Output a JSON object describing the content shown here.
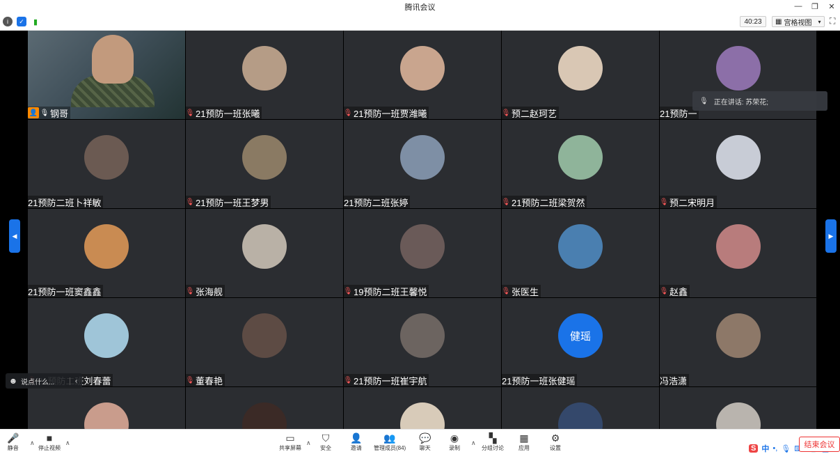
{
  "window": {
    "title": "腾讯会议"
  },
  "toolbar": {
    "timer": "40:23",
    "view_mode": "宫格视图"
  },
  "speaking": {
    "text": "正在讲话: 苏荣花;"
  },
  "chat": {
    "placeholder": "说点什么..."
  },
  "tiles": [
    {
      "name": "钢哥",
      "type": "video",
      "host": true,
      "muted": false
    },
    {
      "name": "21预防一班张曦",
      "muted": true,
      "color": "#b59c86"
    },
    {
      "name": "21预防一班贾潍曦",
      "muted": true,
      "color": "#c9a58e"
    },
    {
      "name": "预二赵珂艺",
      "muted": true,
      "color": "#d9c7b4"
    },
    {
      "name": "21预防一",
      "muted": false,
      "color": "#8c6fa8"
    },
    {
      "name": "21预防二班卜祥敏",
      "muted": false,
      "color": "#6b5a52"
    },
    {
      "name": "21预防一班王梦男",
      "muted": true,
      "color": "#8a7a63"
    },
    {
      "name": "21预防二班张婷",
      "muted": false,
      "color": "#7e8fa5"
    },
    {
      "name": "21预防二班梁贺然",
      "muted": true,
      "color": "#8fb49a"
    },
    {
      "name": "预二宋明月",
      "muted": true,
      "color": "#c8ccd6"
    },
    {
      "name": "21预防一班窦鑫鑫",
      "muted": false,
      "color": "#c98b52"
    },
    {
      "name": "张海舰",
      "muted": true,
      "color": "#b9b1a6"
    },
    {
      "name": "19预防二班王馨悦",
      "muted": true,
      "color": "#6a5a58"
    },
    {
      "name": "张医生",
      "muted": true,
      "color": "#4a7fb0"
    },
    {
      "name": "赵鑫",
      "muted": true,
      "color": "#b87c7c"
    },
    {
      "name": "21预防二班刘春蕾",
      "muted": true,
      "color": "#9fc5d8"
    },
    {
      "name": "董春艳",
      "muted": true,
      "color": "#5d4b44"
    },
    {
      "name": "21预防一班崔宇航",
      "muted": true,
      "color": "#6c6460"
    },
    {
      "name": "21预防一班张健瑶",
      "muted": false,
      "color": "#1a73e8",
      "initials": "健瑶"
    },
    {
      "name": "冯浩潇",
      "muted": false,
      "color": "#8d7868"
    },
    {
      "name": "",
      "muted": false,
      "color": "#c99c8c"
    },
    {
      "name": "",
      "muted": false,
      "color": "#3b2a26"
    },
    {
      "name": "",
      "muted": false,
      "color": "#d8cbb9"
    },
    {
      "name": "",
      "muted": false,
      "color": "#34486b"
    },
    {
      "name": "",
      "muted": false,
      "color": "#b9b4ae"
    }
  ],
  "bottom": {
    "mute": "静音",
    "stop_video": "停止视频",
    "share": "共享屏幕",
    "security": "安全",
    "invite": "邀请",
    "members": "管理成员(84)",
    "chat": "聊天",
    "record": "录制",
    "breakout": "分组讨论",
    "apps": "应用",
    "settings": "设置",
    "leave": "结束会议"
  },
  "ime": {
    "lang": "中"
  },
  "colors": {
    "tile_bg": "#2b2d31",
    "accent": "#1a73e8",
    "host": "#ff8a00",
    "leave": "#e33333"
  }
}
